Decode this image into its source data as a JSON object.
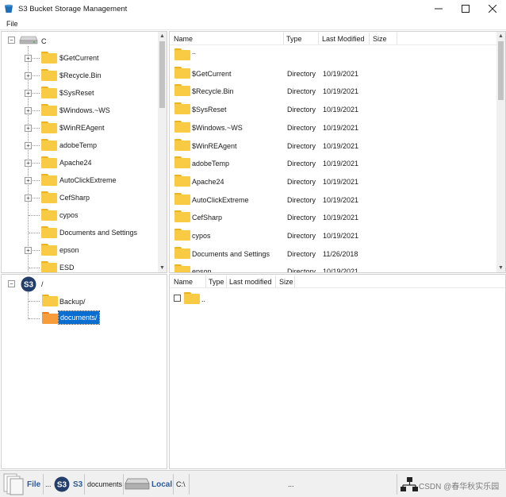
{
  "window": {
    "title": "S3 Bucket Storage Management"
  },
  "menu": {
    "items": [
      "File"
    ]
  },
  "local_tree": {
    "root": "C",
    "items": [
      "$GetCurrent",
      "$Recycle.Bin",
      "$SysReset",
      "$Windows.~WS",
      "$WinREAgent",
      "adobeTemp",
      "Apache24",
      "AutoClickExtreme",
      "CefSharp",
      "cypos",
      "Documents and Settings",
      "epson",
      "ESD"
    ],
    "expandable": [
      true,
      true,
      true,
      true,
      true,
      true,
      true,
      true,
      true,
      false,
      false,
      true,
      false
    ]
  },
  "local_list": {
    "columns": [
      "Name",
      "Type",
      "Last Modified",
      "Size"
    ],
    "rows": [
      {
        "name": "..",
        "type": "",
        "modified": "",
        "size": ""
      },
      {
        "name": "$GetCurrent",
        "type": "Directory",
        "modified": "10/19/2021",
        "size": ""
      },
      {
        "name": "$Recycle.Bin",
        "type": "Directory",
        "modified": "10/19/2021",
        "size": ""
      },
      {
        "name": "$SysReset",
        "type": "Directory",
        "modified": "10/19/2021",
        "size": ""
      },
      {
        "name": "$Windows.~WS",
        "type": "Directory",
        "modified": "10/19/2021",
        "size": ""
      },
      {
        "name": "$WinREAgent",
        "type": "Directory",
        "modified": "10/19/2021",
        "size": ""
      },
      {
        "name": "adobeTemp",
        "type": "Directory",
        "modified": "10/19/2021",
        "size": ""
      },
      {
        "name": "Apache24",
        "type": "Directory",
        "modified": "10/19/2021",
        "size": ""
      },
      {
        "name": "AutoClickExtreme",
        "type": "Directory",
        "modified": "10/19/2021",
        "size": ""
      },
      {
        "name": "CefSharp",
        "type": "Directory",
        "modified": "10/19/2021",
        "size": ""
      },
      {
        "name": "cypos",
        "type": "Directory",
        "modified": "10/19/2021",
        "size": ""
      },
      {
        "name": "Documents and Settings",
        "type": "Directory",
        "modified": "11/26/2018",
        "size": ""
      },
      {
        "name": "epson",
        "type": "Directory",
        "modified": "10/19/2021",
        "size": ""
      }
    ]
  },
  "s3_tree": {
    "root": "/",
    "root_badge": "S3",
    "items": [
      "Backup/",
      "documents/"
    ],
    "selected": "documents/"
  },
  "s3_list": {
    "columns": [
      "Name",
      "Type",
      "Last modified",
      "Size"
    ],
    "rows": [
      {
        "name": ".."
      }
    ]
  },
  "statusbar": {
    "file_label": "File",
    "ellipsis1": "...",
    "s3_badge": "S3",
    "s3_label": "S3",
    "s3_path": "documents",
    "local_label": "Local",
    "local_path": "C:\\",
    "ellipsis2": "...",
    "watermark": "CSDN @春华秋实乐园"
  },
  "colors": {
    "selection": "#0a6ed1",
    "folder": "#f9cb45",
    "folder_open": "#f79c3a",
    "s3_badge": "#233e6b"
  }
}
